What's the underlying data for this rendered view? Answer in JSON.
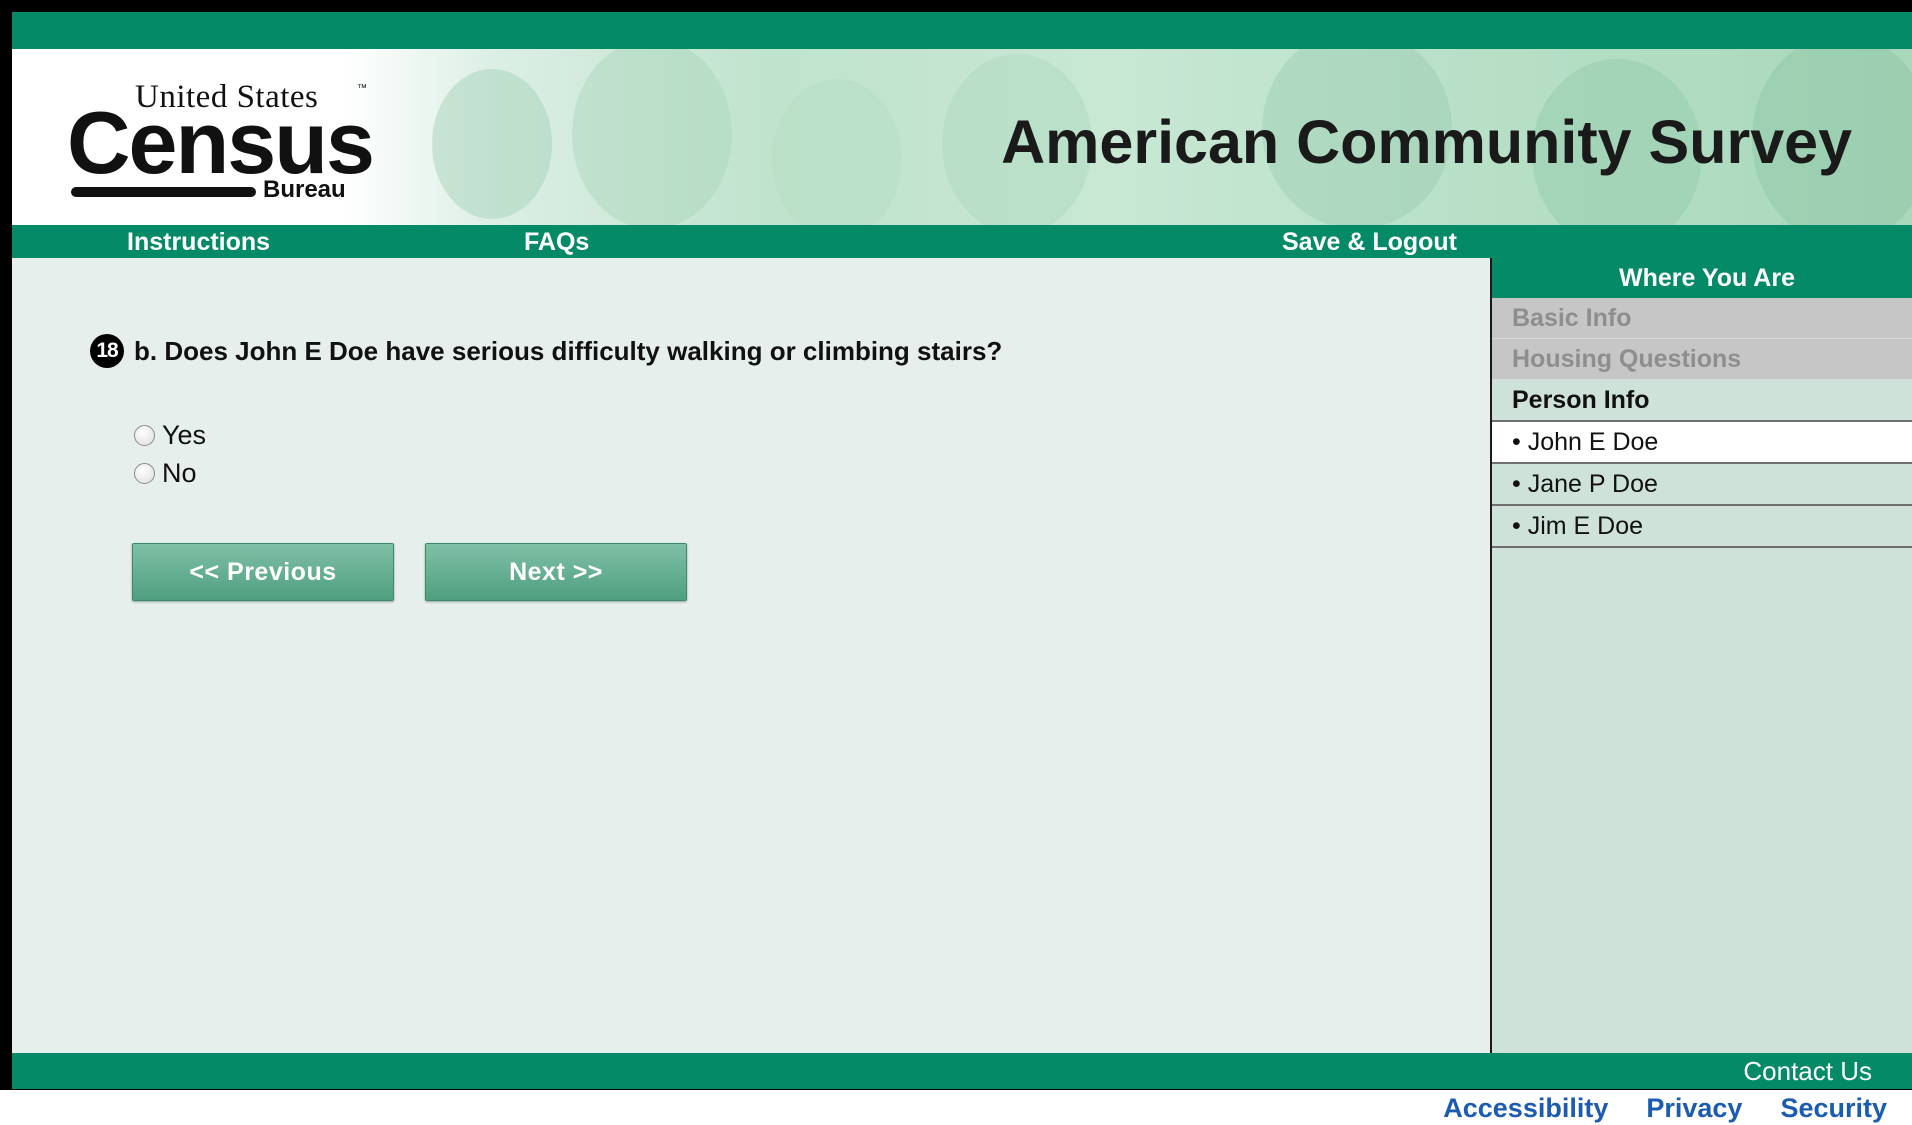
{
  "header": {
    "logo": {
      "top_text": "United States",
      "trademark": "™",
      "main_text": "Census",
      "sub_text": "Bureau"
    },
    "title": "American Community Survey"
  },
  "nav": {
    "instructions": "Instructions",
    "faqs": "FAQs",
    "save_logout": "Save & Logout"
  },
  "question": {
    "number": "18",
    "text": "b. Does John E Doe have serious difficulty walking or climbing stairs?",
    "options": [
      {
        "label": "Yes",
        "selected": false
      },
      {
        "label": "No",
        "selected": false
      }
    ]
  },
  "buttons": {
    "previous": "<<  Previous",
    "next": "Next  >>"
  },
  "sidebar": {
    "heading": "Where You Are",
    "completed": [
      "Basic Info",
      "Housing Questions"
    ],
    "section": "Person Info",
    "persons": [
      "• John E Doe",
      "• Jane P Doe",
      "• Jim E Doe"
    ],
    "active_person": "• John E Doe"
  },
  "footer": {
    "contact": "Contact Us",
    "links": [
      "Accessibility",
      "Privacy",
      "Security"
    ]
  },
  "colors": {
    "brand_green": "#058a68",
    "page_bg": "#e6efec",
    "sidebar_bg": "#cfe2d9",
    "link_blue": "#1c5cb0"
  }
}
